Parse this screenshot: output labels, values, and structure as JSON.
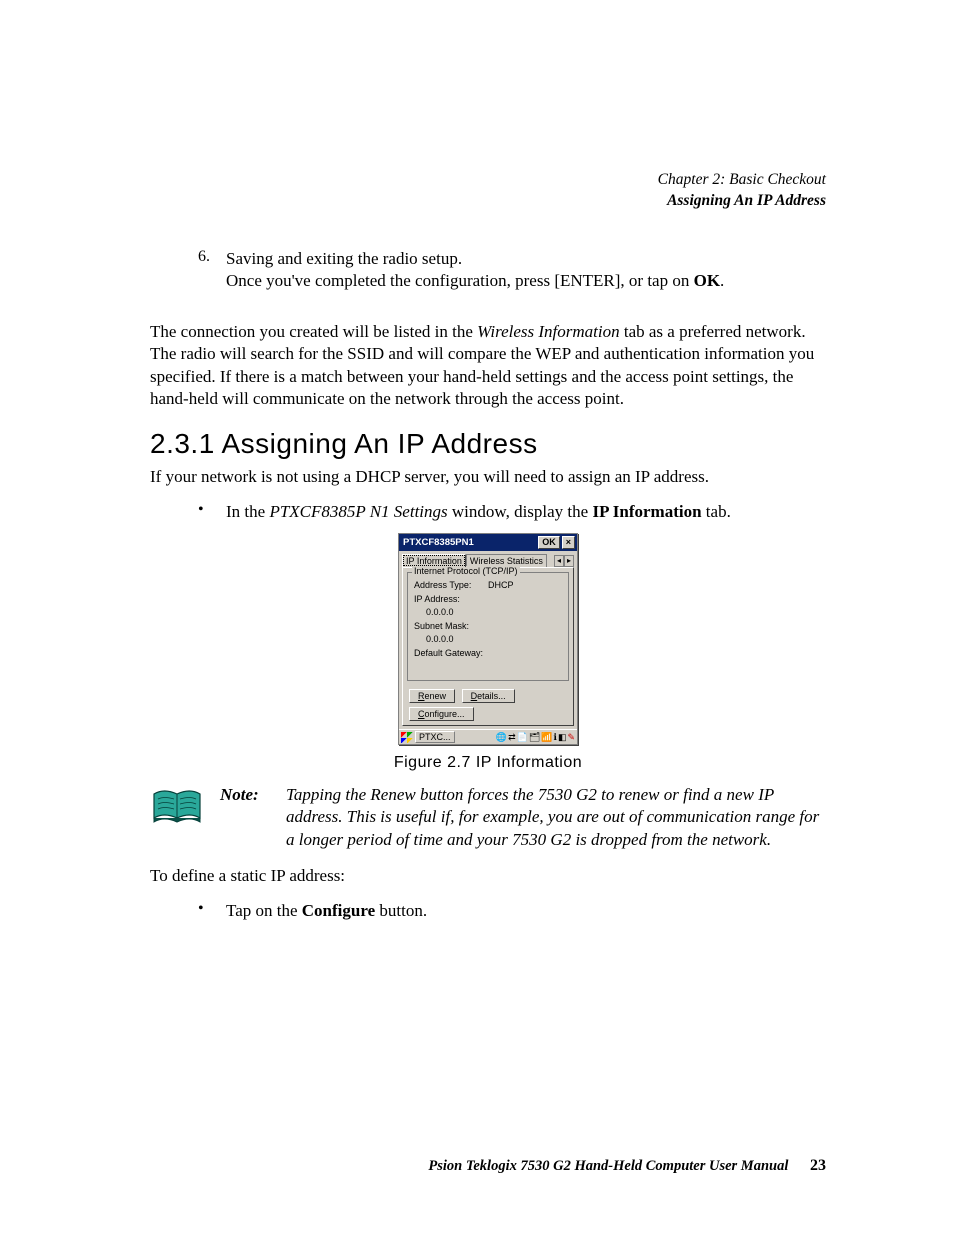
{
  "header": {
    "chapter": "Chapter 2: Basic Checkout",
    "section": "Assigning An IP Address"
  },
  "step6": {
    "num": "6.",
    "line1": "Saving and exiting the radio setup.",
    "line2a": "Once you've completed the configuration, press [ENTER], or tap on ",
    "line2b": "OK",
    "line2c": "."
  },
  "para1": {
    "a": "The connection you created will be listed in the ",
    "b": "Wireless Information",
    "c": " tab as a preferred network. The radio will search for the SSID and will compare the WEP and authentication information you specified. If there is a match between your hand-held settings and the access point settings, the hand-held will communicate on the network through the access point."
  },
  "heading": "2.3.1  Assigning An IP Address",
  "para2": "If your network is not using a DHCP server, you will need to assign an IP address.",
  "bullet1": {
    "a": "In the ",
    "b": "PTXCF8385P N1 Settings",
    "c": " window, display the ",
    "d": "IP Information",
    "e": " tab."
  },
  "dialog": {
    "title": "PTXCF8385PN1",
    "ok": "OK",
    "close": "×",
    "tab1": "IP Information",
    "tab2": "Wireless Statistics",
    "arrow_l": "◂",
    "arrow_r": "▸",
    "legend": "Internet Protocol (TCP/IP)",
    "rows": {
      "addr_type_l": "Address Type:",
      "addr_type_v": "DHCP",
      "ip_l": "IP Address:",
      "ip_v": "0.0.0.0",
      "mask_l": "Subnet Mask:",
      "mask_v": "0.0.0.0",
      "gw_l": "Default Gateway:"
    },
    "btn_renew_u": "R",
    "btn_renew_rest": "enew",
    "btn_details": "Details...",
    "btn_details_u": "D",
    "btn_details_rest": "etails...",
    "btn_configure_u": "C",
    "btn_configure_rest": "onfigure...",
    "task_app": "PTXC...",
    "tray_globe": "🌐",
    "tray_net": "⇄",
    "tray_doc": "📄",
    "tray_cards": "🗂",
    "tray_tower": "📶",
    "tray_info": "ℹ",
    "tray_conn": "◧",
    "tray_pen": "✎"
  },
  "figcaption": "Figure 2.7 IP Information",
  "note": {
    "label": "Note:",
    "body": "Tapping the Renew button forces the 7530 G2 to renew or find a new IP address. This is useful if, for example, you are out of communication range for a longer period of time and your 7530 G2 is dropped from the network."
  },
  "para3": "To define a static IP address:",
  "bullet2": {
    "a": "Tap on the ",
    "b": "Configure",
    "c": " button."
  },
  "footer": {
    "text": "Psion Teklogix 7530 G2 Hand-Held Computer User Manual",
    "page": "23"
  }
}
